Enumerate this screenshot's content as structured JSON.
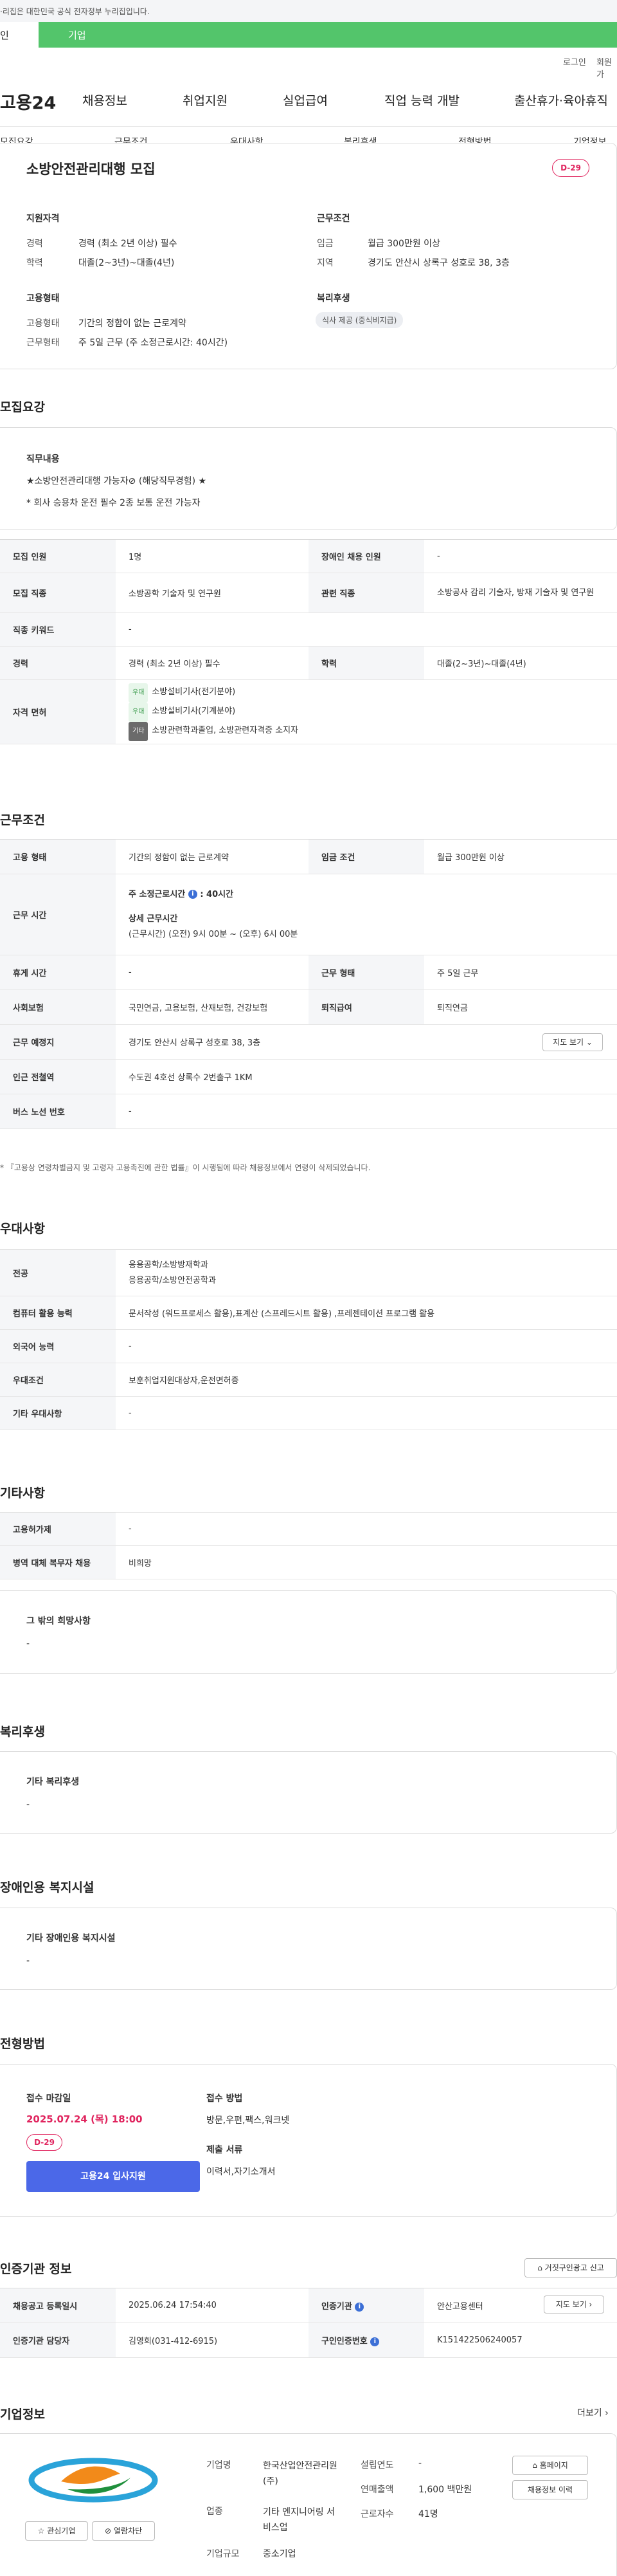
{
  "banner": {
    "text": "·리집은 대한민국 공식 전자정부 누리집입니다."
  },
  "tabs": {
    "individual": "인",
    "business": "기업"
  },
  "util": {
    "login": "로그인",
    "signup": "회원가"
  },
  "logo": {
    "text": "고용24"
  },
  "main_nav": [
    "채용정보",
    "취업지원",
    "실업급여",
    "직업 능력 개발",
    "출산휴가·육아휴직"
  ],
  "sub_nav": [
    "모집요강",
    "근무조건",
    "우대사항",
    "복리후생",
    "전형방법",
    "기업정보"
  ],
  "summary": {
    "title": "소방안전관리대행 모집",
    "dday": "D-29",
    "qualification_heading": "지원자격",
    "career_label": "경력",
    "career_value": "경력 (최소 2년 이상) 필수",
    "edu_label": "학력",
    "edu_value": "대졸(2~3년)~대졸(4년)",
    "conditions_heading": "근무조건",
    "wage_label": "임금",
    "wage_value": "월급 300만원 이상",
    "region_label": "지역",
    "region_value": "경기도 안산시 상록구 성호로 38, 3층",
    "employment_heading": "고용형태",
    "emp_type_label": "고용형태",
    "emp_type_value": "기간의 정함이 없는 근로계약",
    "work_type_label": "근무형태",
    "work_type_value": "주 5일 근무 (주 소정근로시간: 40시간)",
    "welfare_heading": "복리후생",
    "welfare_pill": "식사 제공 (중식비지급)"
  },
  "recruit": {
    "heading": "모집요강",
    "job_desc_heading": "직무내용",
    "job_desc_line1": "★소방안전관리대행 가능자⊘ (해당직무경험) ★",
    "job_desc_line2": "* 회사 승용차 운전 필수 2종 보통 운전 가능자",
    "rows": {
      "headcount_label": "모집 인원",
      "headcount_value": "1명",
      "disabled_label": "장애인 채용 인원",
      "disabled_value": "-",
      "job_label": "모집 직종",
      "job_value": "소방공학 기술자 및 연구원",
      "related_label": "관련 직종",
      "related_value": "소방공사 감리 기술자, 방재 기술자 및 연구원",
      "jobcode_label": "직종 키워드",
      "jobcode_value": "-",
      "career_label": "경력",
      "career_value": "경력 (최소 2년 이상) 필수",
      "edu_label": "학력",
      "edu_value": "대졸(2~3년)~대졸(4년)",
      "license_label": "자격 면허",
      "license_tag1": "우대",
      "license_1": "소방설비기사(전기분야)",
      "license_tag2": "우대",
      "license_2": "소방설비기사(기계분야)",
      "license_tag3": "기타",
      "license_3": "소방관련학과졸업, 소방관련자격증 소지자"
    }
  },
  "work": {
    "heading": "근무조건",
    "emp_label": "고용 형태",
    "emp_value": "기간의 정함이 없는 근로계약",
    "wage_label": "임금 조건",
    "wage_value": "월급 300만원 이상",
    "hours_label": "근무 시간",
    "hours_line1": "주 소정근로시간",
    "hours_line1_value": ": 40시간",
    "hours_detail_heading": "상세 근무시간",
    "hours_detail": "(근무시간) (오전) 9시 00분 ~ (오후) 6시 00분",
    "rest_label": "휴게 시간",
    "rest_value": "-",
    "form_label": "근무 형태",
    "form_value": "주 5일 근무",
    "insurance_label": "사회보험",
    "insurance_value": "국민연금, 고용보험, 산재보험, 건강보험",
    "retire_label": "퇴직급여",
    "retire_value": "퇴직연금",
    "place_label": "근무 예정지",
    "place_value": "경기도 안산시 상록구 성호로 38, 3층",
    "map_button": "지도 보기",
    "subway_label": "인근 전철역",
    "subway_value": "수도권 4호선 상록수 2번출구 1KM",
    "bus_label": "버스 노선 번호",
    "bus_value": "-",
    "note": "* 『고용상 연령차별금지 및 고령자 고용촉진에 관한 법률』이 시행됨에 따라 채용정보에서 연령이 삭제되었습니다."
  },
  "pref": {
    "heading": "우대사항",
    "major_label": "전공",
    "major_1": "응용공학/소방방재학과",
    "major_2": "응용공학/소방안전공학과",
    "computer_label": "컴퓨터 활용 능력",
    "computer_value": "문서작성 (워드프로세스 활용),표계산 (스프레드시트 활용) ,프레젠테이션 프로그램 활용",
    "lang_label": "외국어 능력",
    "lang_value": "-",
    "cond_label": "우대조건",
    "cond_value": "보훈취업지원대상자,운전면허증",
    "other_label": "기타 우대사항",
    "other_value": "-"
  },
  "etc": {
    "heading": "기타사항",
    "duty_label": "고용허가제",
    "duty_value": "-",
    "military_label": "병역 대체 복무자 채용",
    "military_value": "비희망",
    "wish_heading": "그 밖의 희망사항",
    "wish_value": "-"
  },
  "welfare": {
    "heading": "복리후생",
    "card_heading": "기타 복리후생",
    "card_value": "-"
  },
  "disabled": {
    "heading": "장애인용 복지시설",
    "card_heading": "기타 장애인용 복지시설",
    "card_value": "-"
  },
  "process": {
    "heading": "전형방법",
    "deadline_heading": "접수 마감일",
    "deadline": "2025.07.24 (목) 18:00",
    "dday": "D-29",
    "apply_button": "고용24 입사지원",
    "method_heading": "접수 방법",
    "method_value": "방문,우편,팩스,워크넷",
    "docs_heading": "제출 서류",
    "docs_value": "이력서,자기소개서"
  },
  "cert": {
    "heading": "인증기관 정보",
    "report_button": "거짓구인광고 신고",
    "date_label": "채용공고 등록일시",
    "date_value": "2025.06.24 17:54:40",
    "agency_label": "인증기관",
    "agency_value": "안산고용센터",
    "manager_label": "인증기관 담당자",
    "manager_value": "김영희(031-412-6915)",
    "map_button": "지도 보기",
    "bizno_label": "구인인증번호",
    "bizno_value": "K151422506240057"
  },
  "company": {
    "heading": "기업정보",
    "more": "더보기",
    "fav_button": "관심기업",
    "block_button": "열람차단",
    "name_label": "기업명",
    "name_value": "한국산업안전관리원(주)",
    "industry_label": "업종",
    "industry_value": "기타 엔지니어링 서비스업",
    "size_label": "기업규모",
    "size_value": "중소기업",
    "founded_label": "설립연도",
    "founded_value": "-",
    "revenue_label": "연매출액",
    "revenue_value": "1,600 백만원",
    "employees_label": "근로자수",
    "employees_value": "41명",
    "homepage_button": "홈페이지",
    "jobs_button": "채용정보 이력"
  },
  "colors": {
    "accent": "#53c56b",
    "dday": "#e0245e",
    "apply_button": "#4b68e8",
    "link": "#3c6fd6"
  }
}
